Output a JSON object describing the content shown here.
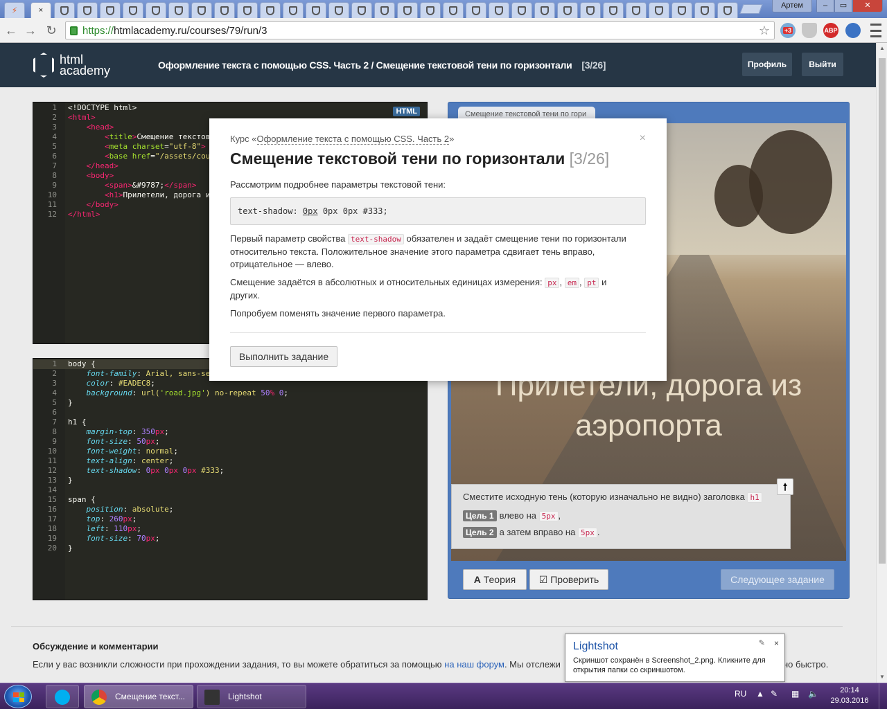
{
  "browser": {
    "tab_close": "×",
    "user_label": "Артем",
    "url_scheme": "https://",
    "url_rest": "htmlacademy.ru/courses/79/run/3",
    "ext_badge": "+3",
    "abp_label": "ABP"
  },
  "header": {
    "logo_line1": "html",
    "logo_line2": "academy",
    "course": "Оформление текста с помощью CSS. Часть 2",
    "separator": " / ",
    "lesson": "Смещение текстовой тени по горизонтали",
    "counter": "[3/26]",
    "profile_btn": "Профиль",
    "logout_btn": "Выйти"
  },
  "html_editor": {
    "badge": "HTML",
    "lines": [
      [
        [
          "",
          "<!DOCTYPE html>"
        ]
      ],
      [
        [
          "t-tag",
          "<html>"
        ]
      ],
      [
        [
          "",
          "    "
        ],
        [
          "t-tag",
          "<head>"
        ]
      ],
      [
        [
          "",
          "        "
        ],
        [
          "t-tag",
          "<"
        ],
        [
          "t-attr",
          "title"
        ],
        [
          "t-tag",
          ">"
        ],
        [
          "",
          "Смещение текстово"
        ]
      ],
      [
        [
          "",
          "        "
        ],
        [
          "t-tag",
          "<"
        ],
        [
          "t-attr",
          "meta "
        ],
        [
          "t-attr",
          "charset"
        ],
        [
          "",
          "="
        ],
        [
          "t-str",
          "\"utf-8\""
        ],
        [
          "t-tag",
          ">"
        ]
      ],
      [
        [
          "",
          "        "
        ],
        [
          "t-tag",
          "<"
        ],
        [
          "t-attr",
          "base "
        ],
        [
          "t-attr",
          "href"
        ],
        [
          "",
          "="
        ],
        [
          "t-str",
          "\"/assets/cour"
        ]
      ],
      [
        [
          "",
          "    "
        ],
        [
          "t-tag",
          "</head>"
        ]
      ],
      [
        [
          "",
          "    "
        ],
        [
          "t-tag",
          "<body>"
        ]
      ],
      [
        [
          "",
          "        "
        ],
        [
          "t-tag",
          "<span>"
        ],
        [
          "",
          "&#9787;"
        ],
        [
          "t-tag",
          "</span>"
        ]
      ],
      [
        [
          "",
          "        "
        ],
        [
          "t-tag",
          "<h1>"
        ],
        [
          "",
          "Прилетели, дорога и"
        ]
      ],
      [
        [
          "",
          "    "
        ],
        [
          "t-tag",
          "</body>"
        ]
      ],
      [
        [
          "t-tag",
          "</html>"
        ]
      ]
    ]
  },
  "css_editor": {
    "lines": [
      [
        [
          "",
          "body {"
        ]
      ],
      [
        [
          "",
          "    "
        ],
        [
          "t-prop",
          "font-family"
        ],
        [
          "",
          ": "
        ],
        [
          "t-str",
          "Arial, sans-se"
        ]
      ],
      [
        [
          "",
          "    "
        ],
        [
          "t-prop",
          "color"
        ],
        [
          "",
          ": "
        ],
        [
          "t-str",
          "#EADEC8"
        ],
        [
          "",
          ";"
        ]
      ],
      [
        [
          "",
          "    "
        ],
        [
          "t-prop",
          "background"
        ],
        [
          "",
          ": "
        ],
        [
          "t-str",
          "url("
        ],
        [
          "t-attr",
          "'road.jpg'"
        ],
        [
          "t-str",
          ") no-repeat "
        ],
        [
          "t-num",
          "50"
        ],
        [
          "t-unit",
          "%"
        ],
        [
          "",
          " "
        ],
        [
          "t-num",
          "0"
        ],
        [
          "",
          ";"
        ]
      ],
      [
        [
          "",
          "}"
        ]
      ],
      [
        [
          "",
          ""
        ]
      ],
      [
        [
          "",
          "h1 {"
        ]
      ],
      [
        [
          "",
          "    "
        ],
        [
          "t-prop",
          "margin-top"
        ],
        [
          "",
          ": "
        ],
        [
          "t-num",
          "350"
        ],
        [
          "t-unit",
          "px"
        ],
        [
          "",
          ";"
        ]
      ],
      [
        [
          "",
          "    "
        ],
        [
          "t-prop",
          "font-size"
        ],
        [
          "",
          ": "
        ],
        [
          "t-num",
          "50"
        ],
        [
          "t-unit",
          "px"
        ],
        [
          "",
          ";"
        ]
      ],
      [
        [
          "",
          "    "
        ],
        [
          "t-prop",
          "font-weight"
        ],
        [
          "",
          ": "
        ],
        [
          "t-str",
          "normal"
        ],
        [
          "",
          ";"
        ]
      ],
      [
        [
          "",
          "    "
        ],
        [
          "t-prop",
          "text-align"
        ],
        [
          "",
          ": "
        ],
        [
          "t-str",
          "center"
        ],
        [
          "",
          ";"
        ]
      ],
      [
        [
          "",
          "    "
        ],
        [
          "t-prop",
          "text-shadow"
        ],
        [
          "",
          ": "
        ],
        [
          "t-num",
          "0"
        ],
        [
          "t-unit",
          "px"
        ],
        [
          "",
          " "
        ],
        [
          "t-num",
          "0"
        ],
        [
          "t-unit",
          "px"
        ],
        [
          "",
          " "
        ],
        [
          "t-num",
          "0"
        ],
        [
          "t-unit",
          "px"
        ],
        [
          "",
          " "
        ],
        [
          "t-str",
          "#333"
        ],
        [
          "",
          ";"
        ]
      ],
      [
        [
          "",
          "}"
        ]
      ],
      [
        [
          "",
          ""
        ]
      ],
      [
        [
          "",
          "span {"
        ]
      ],
      [
        [
          "",
          "    "
        ],
        [
          "t-prop",
          "position"
        ],
        [
          "",
          ": "
        ],
        [
          "t-str",
          "absolute"
        ],
        [
          "",
          ";"
        ]
      ],
      [
        [
          "",
          "    "
        ],
        [
          "t-prop",
          "top"
        ],
        [
          "",
          ": "
        ],
        [
          "t-num",
          "260"
        ],
        [
          "t-unit",
          "px"
        ],
        [
          "",
          ";"
        ]
      ],
      [
        [
          "",
          "    "
        ],
        [
          "t-prop",
          "left"
        ],
        [
          "",
          ": "
        ],
        [
          "t-num",
          "110"
        ],
        [
          "t-unit",
          "px"
        ],
        [
          "",
          ";"
        ]
      ],
      [
        [
          "",
          "    "
        ],
        [
          "t-prop",
          "font-size"
        ],
        [
          "",
          ": "
        ],
        [
          "t-num",
          "70"
        ],
        [
          "t-unit",
          "px"
        ],
        [
          "",
          ";"
        ]
      ],
      [
        [
          "",
          "}"
        ]
      ]
    ]
  },
  "preview": {
    "tab_label": "Смещение текстовой тени по гори",
    "heading": "Прилетели, дорога из аэропорта",
    "task_intro": "Сместите исходную тень (которую изначально не видно) заголовка",
    "task_intro_code": "h1",
    "goal1_badge": "Цель 1",
    "goal1_text": "влево на",
    "goal1_code": "5px",
    "goal1_end": ",",
    "goal2_badge": "Цель 2",
    "goal2_text": "а затем вправо на",
    "goal2_code": "5px",
    "goal2_end": ".",
    "collapse_icon": "🠕",
    "theory_btn": "Теория",
    "theory_icon": "A",
    "check_btn": "Проверить",
    "check_icon": "☑",
    "next_btn": "Следующее задание"
  },
  "modal": {
    "course_prefix": "Курс «",
    "course_link": "Оформление текста с помощью CSS. Часть 2",
    "course_suffix": "»",
    "close": "×",
    "title": "Смещение текстовой тени по горизонтали",
    "title_count": "[3/26]",
    "p1": "Рассмотрим подробнее параметры текстовой тени:",
    "code_prefix": "text-shadow: ",
    "code_highlight": "0px",
    "code_suffix": " 0px 0px #333;",
    "p2_before": "Первый параметр свойства",
    "p2_code": "text-shadow",
    "p2_after": "обязателен и задаёт смещение тени по горизонтали относительно текста. Положительное значение этого параметра сдвигает тень вправо, отрицательное — влево.",
    "p3_before": "Смещение задаётся в абсолютных и относительных единицах измерения:",
    "p3_units": [
      "px",
      "em",
      "pt"
    ],
    "p3_after": "и других.",
    "p4": "Попробуем поменять значение первого параметра.",
    "action_btn": "Выполнить задание"
  },
  "discussion": {
    "title": "Обсуждение и комментарии",
    "text_before": "Если у вас возникли сложности при прохождении задания, то вы можете обратиться за помощью",
    "link": "на наш форум",
    "text_after": ". Мы отслежи",
    "tail": "но быстро."
  },
  "lightshot": {
    "title": "Lightshot",
    "message": "Скриншот сохранён в Screenshot_2.png. Кликните для открытия папки со скриншотом.",
    "close": "×",
    "pin": "✎"
  },
  "taskbar": {
    "chrome_item": "Смещение текст...",
    "lightshot_item": "Lightshot",
    "lang": "RU",
    "time": "20:14",
    "date": "29.03.2016"
  }
}
